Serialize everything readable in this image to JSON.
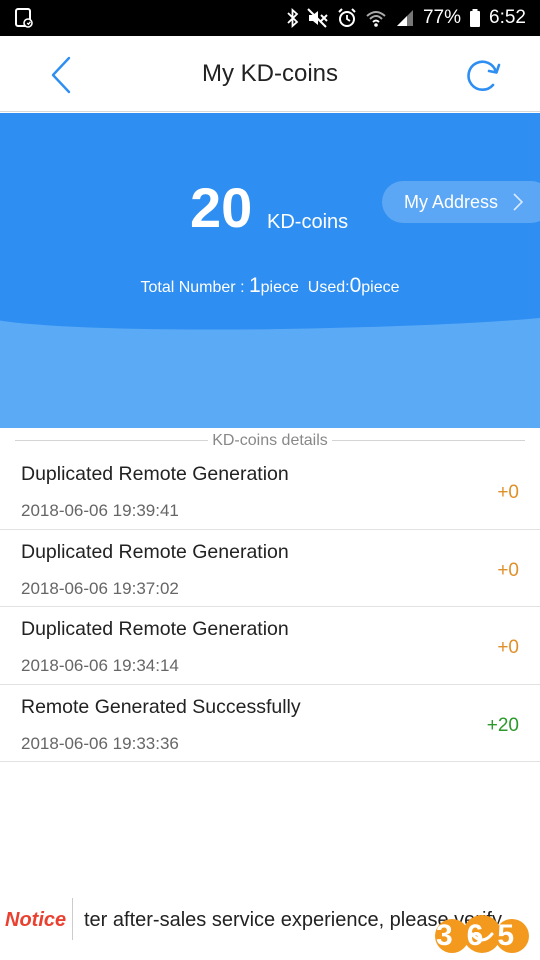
{
  "status_bar": {
    "battery": "77%",
    "time": "6:52",
    "icons": [
      "screenshot-icon",
      "bluetooth-icon",
      "mute-icon",
      "alarm-icon",
      "wifi-icon",
      "signal-icon",
      "battery-icon"
    ]
  },
  "header": {
    "title": "My KD-coins",
    "back_icon": "chevron-left-icon",
    "refresh_icon": "refresh-icon"
  },
  "summary": {
    "amount": "20",
    "unit": "KD-coins",
    "address_button": "My Address",
    "total_label": "Total Number : ",
    "total_value": "1",
    "piece_label_1": "piece",
    "used_label": "  Used:",
    "used_value": "0",
    "piece_label_2": "piece"
  },
  "details": {
    "title": "KD-coins details",
    "transactions": [
      {
        "name": "Duplicated Remote Generation",
        "time": "2018-06-06 19:39:41",
        "amount": "+0"
      },
      {
        "name": "Duplicated Remote Generation",
        "time": "2018-06-06 19:37:02",
        "amount": "+0"
      },
      {
        "name": "Duplicated Remote Generation",
        "time": "2018-06-06 19:34:14",
        "amount": "+0"
      },
      {
        "name": "Remote Generated Successfully",
        "time": "2018-06-06 19:33:36",
        "amount": "+20"
      }
    ]
  },
  "notice": {
    "label": "Notice",
    "text": "ter after-sales service experience, please verify"
  },
  "logo": {
    "text": "365"
  },
  "colors": {
    "accent_blue": "#2e8ef2",
    "light_blue": "#5aaaf6",
    "zero_amount": "#e0902a",
    "positive_amount": "#2b9a2b",
    "notice_red": "#e9402f"
  }
}
